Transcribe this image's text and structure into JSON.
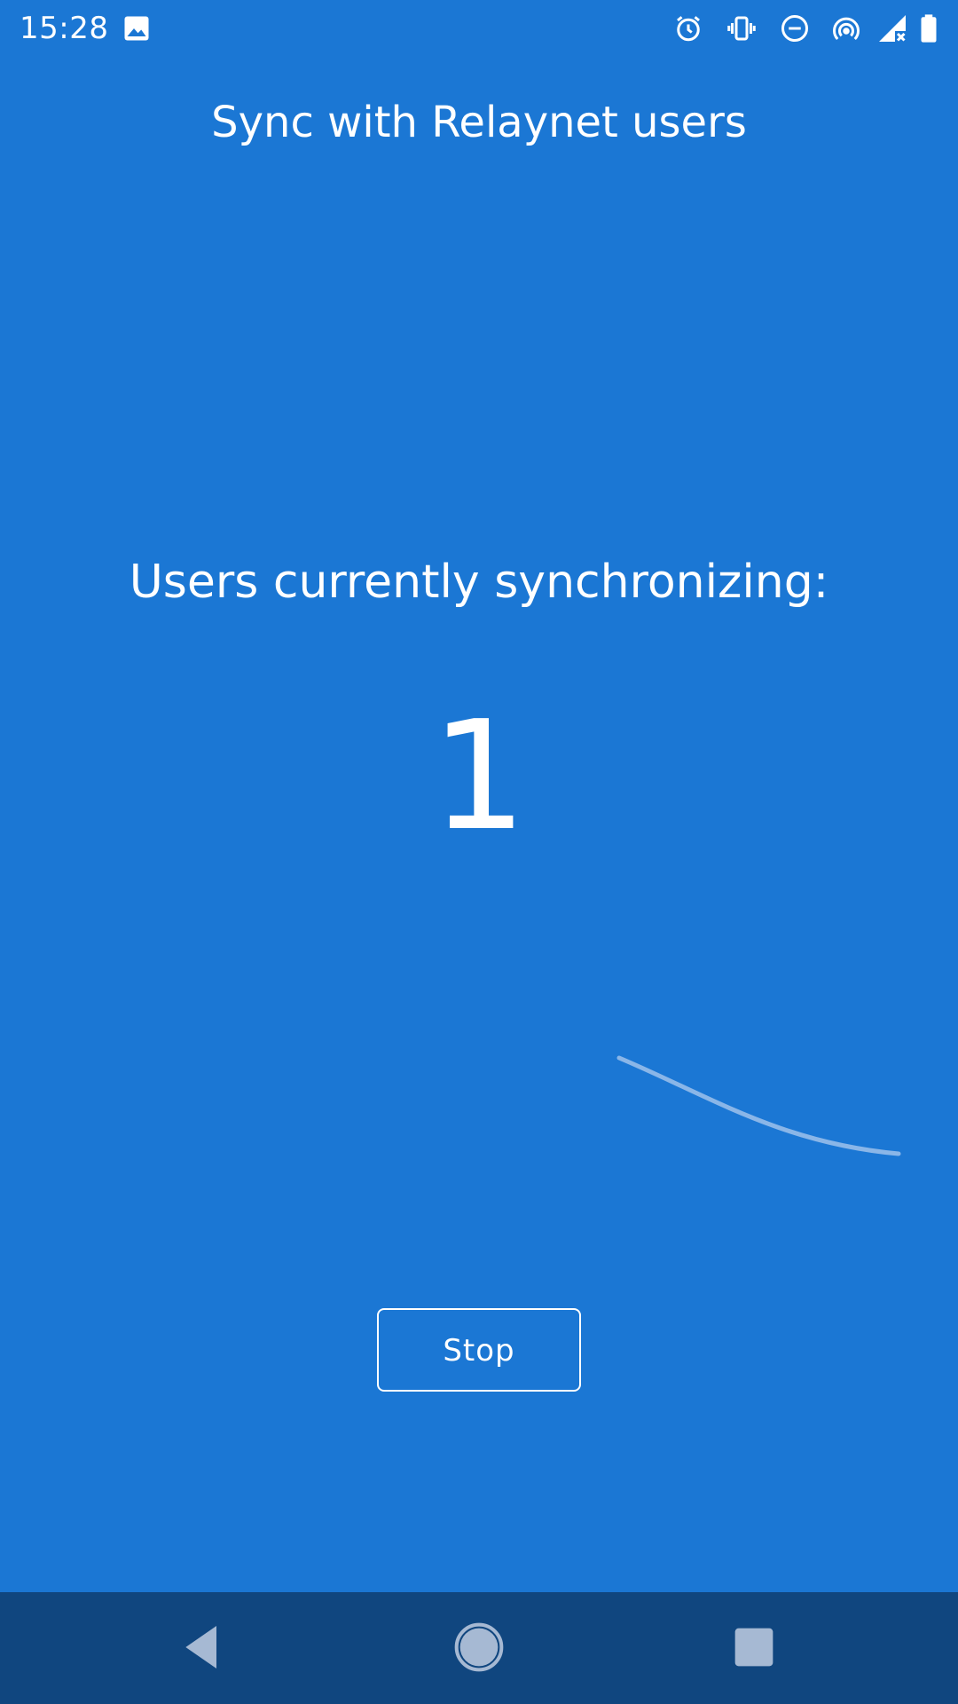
{
  "status_bar": {
    "time": "15:28",
    "icons": [
      "image-icon",
      "alarm-icon",
      "vibrate-icon",
      "do-not-disturb-icon",
      "hotspot-icon",
      "signal-icon",
      "battery-icon"
    ]
  },
  "header": {
    "title": "Sync with Relaynet users"
  },
  "main": {
    "subtitle": "Users currently synchronizing:",
    "user_count": "1",
    "stop_label": "Stop"
  },
  "nav_bar": {
    "icons": [
      "back-icon",
      "home-icon",
      "recents-icon"
    ]
  },
  "colors": {
    "background": "#1b77d4",
    "nav_background": "#10467f",
    "text": "#ffffff",
    "nav_icon": "#a6b9d3"
  }
}
